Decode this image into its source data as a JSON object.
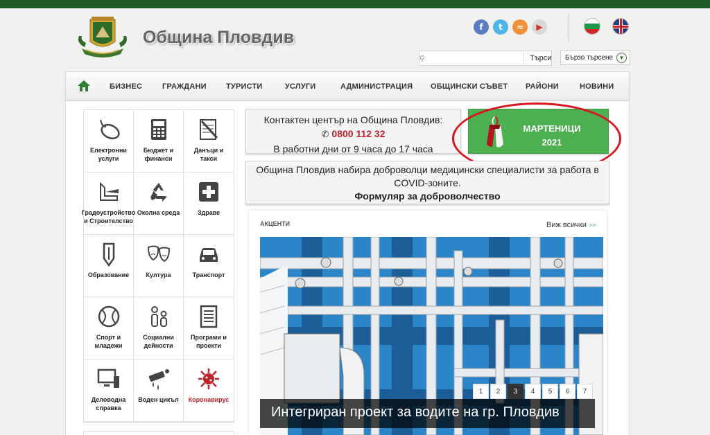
{
  "header": {
    "title": "Община Пловдив",
    "social": [
      {
        "name": "facebook-icon",
        "glyph": "f",
        "color": "#5b7ec2"
      },
      {
        "name": "twitter-icon",
        "glyph": "t",
        "color": "#4fb5e6"
      },
      {
        "name": "rss-icon",
        "glyph": "≈",
        "color": "#f0903a"
      },
      {
        "name": "youtube-icon",
        "glyph": "▶",
        "color": "#d8d8d8"
      }
    ],
    "search": {
      "placeholder": "",
      "button": "Търси"
    },
    "quick_search": {
      "label": "Бързо търсене",
      "glyph": "▼"
    }
  },
  "nav": {
    "items": [
      "БИЗНЕС",
      "ГРАЖДАНИ",
      "ТУРИСТИ",
      "УСЛУГИ",
      "АДМИНИСТРАЦИЯ",
      "ОБЩИНСКИ СЪВЕТ",
      "РАЙОНИ",
      "НОВИНИ"
    ]
  },
  "services": [
    {
      "label": "Електронни услуги",
      "icon": "mouse-icon"
    },
    {
      "label": "Бюджет и финанси",
      "icon": "calculator-icon"
    },
    {
      "label": "Данъци и такси",
      "icon": "notepad-pencil-icon"
    },
    {
      "label": "Градоустройство и Строителство",
      "icon": "ruler-icon"
    },
    {
      "label": "Околна среда",
      "icon": "recycle-icon"
    },
    {
      "label": "Здраве",
      "icon": "health-cross-icon"
    },
    {
      "label": "Образование",
      "icon": "pencil-icon"
    },
    {
      "label": "Култура",
      "icon": "theater-masks-icon"
    },
    {
      "label": "Транспорт",
      "icon": "car-icon"
    },
    {
      "label": "Спорт и младежи",
      "icon": "ball-icon"
    },
    {
      "label": "Социални дейности",
      "icon": "people-icon"
    },
    {
      "label": "Програми и проекти",
      "icon": "document-icon"
    },
    {
      "label": "Деловодна справка",
      "icon": "computer-icon"
    },
    {
      "label": "Воден цикъл",
      "icon": "water-pipe-icon"
    },
    {
      "label": "Коронавирус",
      "icon": "virus-icon",
      "highlight": true
    }
  ],
  "contact": {
    "line1": "Контактен център на Община Пловдив:",
    "phone": "0800 112 32",
    "line3": "В работни дни от 9 часа до 17 часа"
  },
  "promo": {
    "title": "МАРТЕНИЦИ",
    "year": "2021"
  },
  "volunteer": {
    "text": "Община Пловдив набира доброволци медицински специалисти за работа в COVID-зоните.",
    "link": "Формуляр за доброволчество"
  },
  "highlights": {
    "title": "АКЦЕНТИ",
    "view_all": "Виж всички",
    "view_all_arrows": ">>",
    "pages": [
      "1",
      "2",
      "3",
      "4",
      "5",
      "6",
      "7"
    ],
    "active_page": "3",
    "caption": "Интегриран проект за водите на гр. Пловдив"
  },
  "colors": {
    "brand": "#1f5a25",
    "accent_green": "#4caf50",
    "phone_red": "#c0212a",
    "highlight_ring": "#d9161f"
  }
}
